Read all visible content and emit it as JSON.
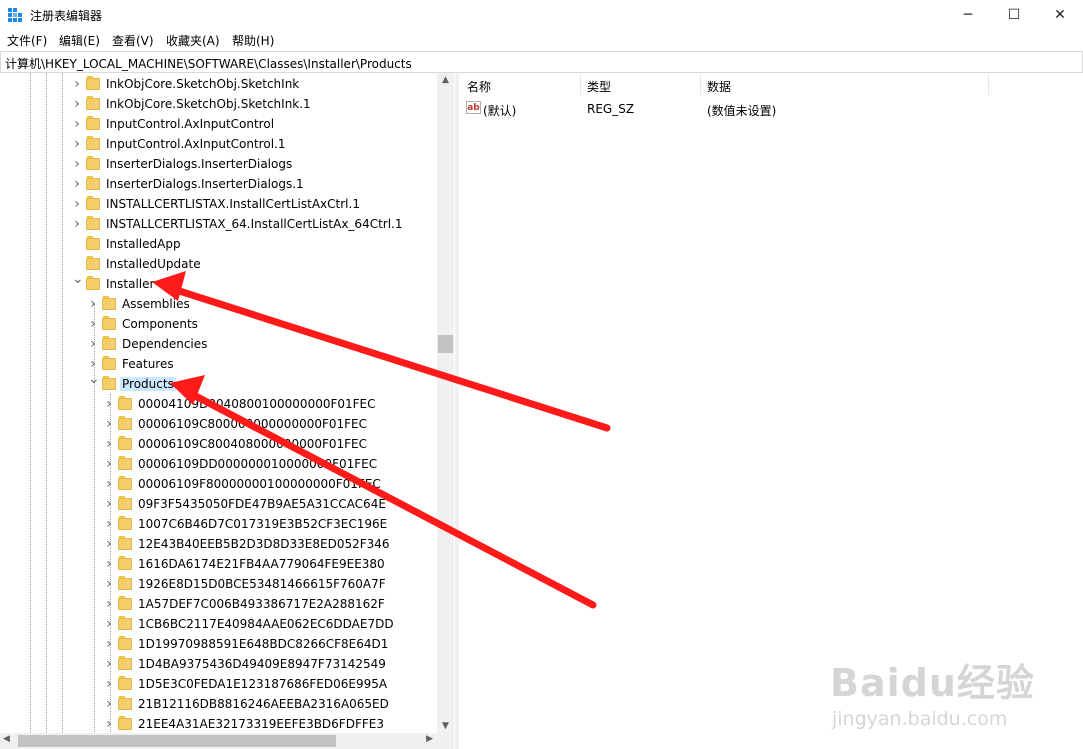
{
  "window": {
    "title": "注册表编辑器",
    "minimize_glyph": "─",
    "maximize_glyph": "☐",
    "close_glyph": "✕"
  },
  "menu": [
    "文件(F)",
    "编辑(E)",
    "查看(V)",
    "收藏夹(A)",
    "帮助(H)"
  ],
  "address": "计算机\\HKEY_LOCAL_MACHINE\\SOFTWARE\\Classes\\Installer\\Products",
  "tree": {
    "selected": "Products",
    "rows": [
      {
        "label": "InkObjCore.SketchObj.SketchInk",
        "level": 0,
        "expander": "collapsed"
      },
      {
        "label": "InkObjCore.SketchObj.SketchInk.1",
        "level": 0,
        "expander": "collapsed"
      },
      {
        "label": "InputControl.AxInputControl",
        "level": 0,
        "expander": "collapsed"
      },
      {
        "label": "InputControl.AxInputControl.1",
        "level": 0,
        "expander": "collapsed"
      },
      {
        "label": "InserterDialogs.InserterDialogs",
        "level": 0,
        "expander": "collapsed"
      },
      {
        "label": "InserterDialogs.InserterDialogs.1",
        "level": 0,
        "expander": "collapsed"
      },
      {
        "label": "INSTALLCERTLISTAX.InstallCertListAxCtrl.1",
        "level": 0,
        "expander": "collapsed"
      },
      {
        "label": "INSTALLCERTLISTAX_64.InstallCertListAx_64Ctrl.1",
        "level": 0,
        "expander": "collapsed"
      },
      {
        "label": "InstalledApp",
        "level": 0,
        "expander": "none"
      },
      {
        "label": "InstalledUpdate",
        "level": 0,
        "expander": "none"
      },
      {
        "label": "Installer",
        "level": 0,
        "expander": "expanded"
      },
      {
        "label": "Assemblies",
        "level": 1,
        "expander": "collapsed"
      },
      {
        "label": "Components",
        "level": 1,
        "expander": "collapsed"
      },
      {
        "label": "Dependencies",
        "level": 1,
        "expander": "collapsed"
      },
      {
        "label": "Features",
        "level": 1,
        "expander": "collapsed"
      },
      {
        "label": "Products",
        "level": 1,
        "expander": "expanded"
      },
      {
        "label": "00004109D0040800100000000F01FEC",
        "level": 2,
        "expander": "collapsed"
      },
      {
        "label": "00006109C800000000000000F01FEC",
        "level": 2,
        "expander": "collapsed"
      },
      {
        "label": "00006109C800408000000000F01FEC",
        "level": 2,
        "expander": "collapsed"
      },
      {
        "label": "00006109DD000000010000000F01FEC",
        "level": 2,
        "expander": "collapsed"
      },
      {
        "label": "00006109F80000000100000000F01FEC",
        "level": 2,
        "expander": "collapsed"
      },
      {
        "label": "09F3F5435050FDE47B9AE5A31CCAC64E",
        "level": 2,
        "expander": "collapsed"
      },
      {
        "label": "1007C6B46D7C017319E3B52CF3EC196E",
        "level": 2,
        "expander": "collapsed"
      },
      {
        "label": "12E43B40EEB5B2D3D8D33E8ED052F346",
        "level": 2,
        "expander": "collapsed"
      },
      {
        "label": "1616DA6174E21FB4AA779064FE9EE380",
        "level": 2,
        "expander": "collapsed"
      },
      {
        "label": "1926E8D15D0BCE53481466615F760A7F",
        "level": 2,
        "expander": "collapsed"
      },
      {
        "label": "1A57DEF7C006B493386717E2A288162F",
        "level": 2,
        "expander": "collapsed"
      },
      {
        "label": "1CB6BC2117E40984AAE062EC6DDAE7DD",
        "level": 2,
        "expander": "collapsed"
      },
      {
        "label": "1D19970988591E648BDC8266CF8E64D1",
        "level": 2,
        "expander": "collapsed"
      },
      {
        "label": "1D4BA9375436D49409E8947F73142549",
        "level": 2,
        "expander": "collapsed"
      },
      {
        "label": "1D5E3C0FEDA1E123187686FED06E995A",
        "level": 2,
        "expander": "collapsed"
      },
      {
        "label": "21B12116DB8816246AEEBA2316A065ED",
        "level": 2,
        "expander": "collapsed"
      },
      {
        "label": "21EE4A31AE32173319EEFE3BD6FDFFE3",
        "level": 2,
        "expander": "collapsed"
      }
    ]
  },
  "list": {
    "columns": [
      "名称",
      "类型",
      "数据"
    ],
    "rows": [
      {
        "name": "(默认)",
        "type": "REG_SZ",
        "data": "(数值未设置)",
        "icon": "string-value-icon"
      }
    ]
  },
  "annotation": {
    "color": "#ff1a1a"
  },
  "watermark": {
    "logo": "Baidu经验",
    "url": "jingyan.baidu.com"
  }
}
